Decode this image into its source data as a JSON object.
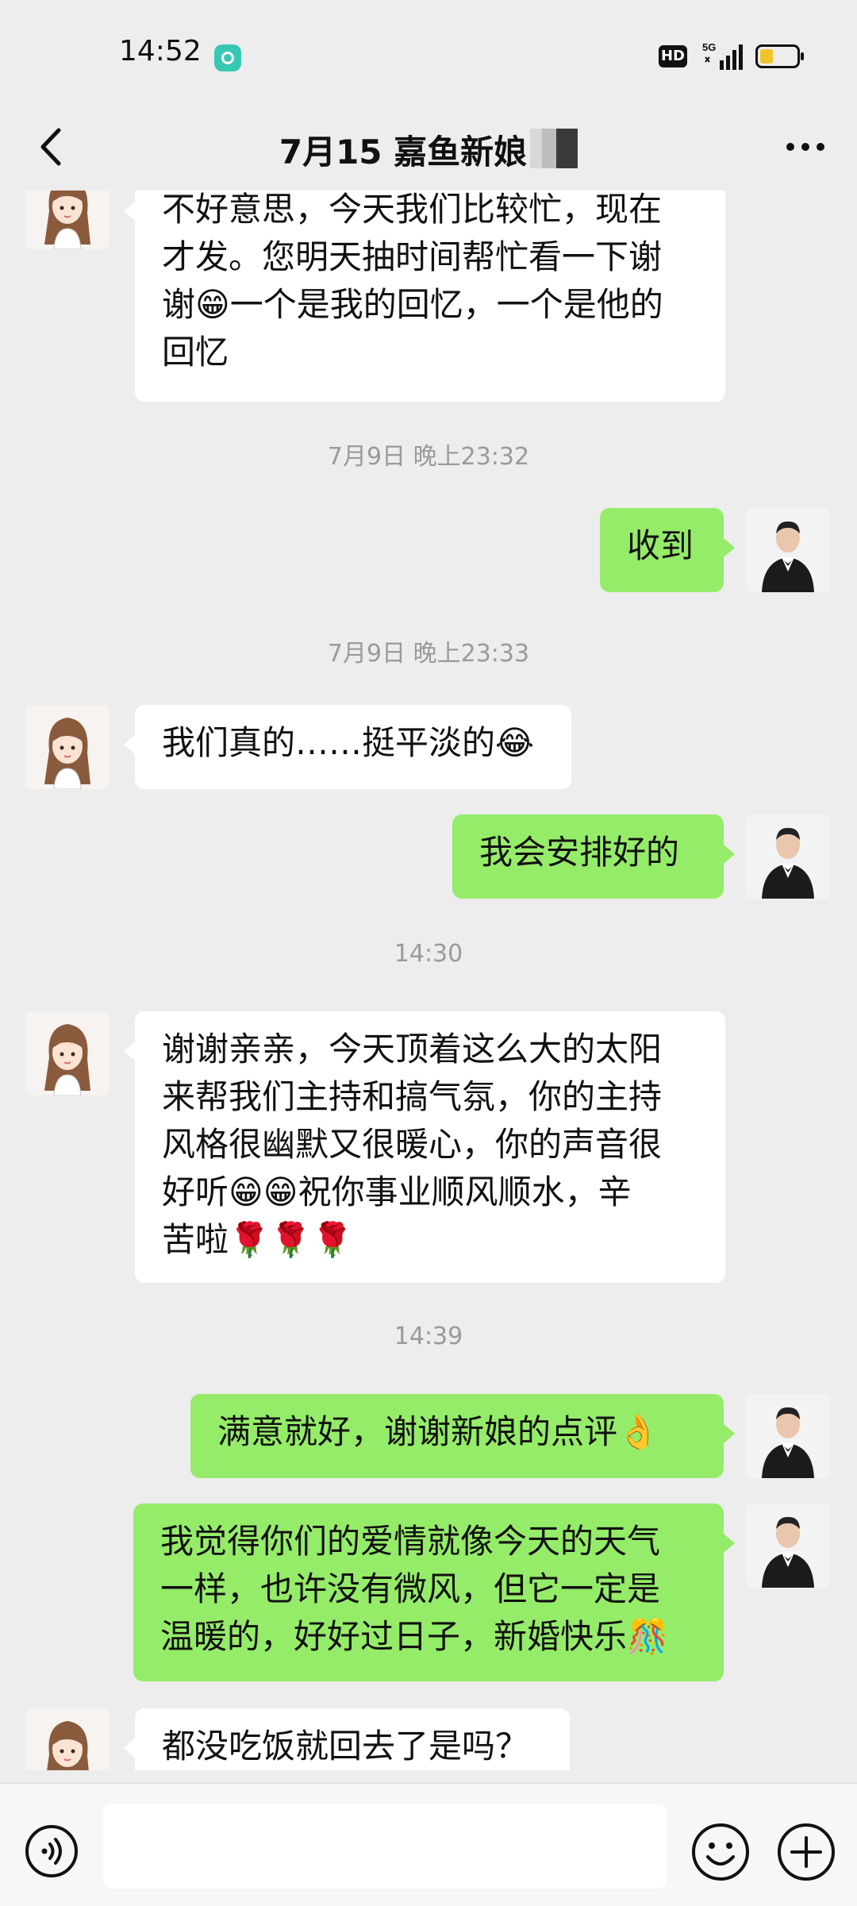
{
  "status_bar": {
    "time": "14:52",
    "network": "5G",
    "hd": "HD"
  },
  "header": {
    "title": "7月15 嘉鱼新娘"
  },
  "messages": [
    {
      "type": "in",
      "text": "不好意思，今天我们比较忙，现在\n才发。您明天抽时间帮忙看一下谢\n谢😁一个是我的回忆，一个是他的\n回忆"
    },
    {
      "type": "time",
      "text": "7月9日 晚上23:32"
    },
    {
      "type": "out",
      "text": "收到"
    },
    {
      "type": "time",
      "text": "7月9日 晚上23:33"
    },
    {
      "type": "in",
      "text": "我们真的……挺平淡的😂"
    },
    {
      "type": "out",
      "text": "我会安排好的"
    },
    {
      "type": "time",
      "text": "14:30"
    },
    {
      "type": "in",
      "text": "谢谢亲亲，今天顶着这么大的太阳\n来帮我们主持和搞气氛，你的主持\n风格很幽默又很暖心，你的声音很\n好听😁😁祝你事业顺风顺水，辛\n苦啦🌹🌹🌹"
    },
    {
      "type": "time",
      "text": "14:39"
    },
    {
      "type": "out",
      "text": "满意就好，谢谢新娘的点评👌"
    },
    {
      "type": "out",
      "text": "我觉得你们的爱情就像今天的天气\n一样，也许没有微风，但它一定是\n温暖的，好好过日子，新婚快乐🎊"
    },
    {
      "type": "in",
      "text": "都没吃饭就回去了是吗？"
    }
  ],
  "input": {
    "placeholder": ""
  },
  "colors": {
    "background": "#ededed",
    "outgoing_bubble": "#95ec69",
    "incoming_bubble": "#ffffff",
    "timestamp": "#9a9a9a"
  },
  "icons": {
    "back": "chevron-left-icon",
    "more": "more-dots-icon",
    "voice": "voice-icon",
    "emoji": "emoji-icon",
    "plus": "plus-icon"
  }
}
